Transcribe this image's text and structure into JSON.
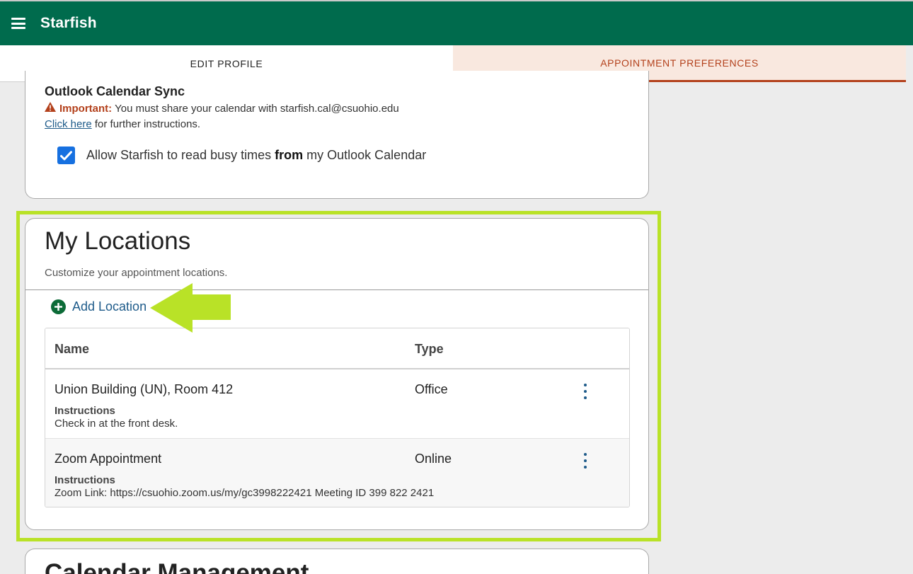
{
  "app": {
    "title": "Starfish"
  },
  "tabs": [
    {
      "label": "EDIT PROFILE",
      "active": false
    },
    {
      "label": "APPOINTMENT PREFERENCES",
      "active": true
    }
  ],
  "outlook": {
    "title": "Outlook Calendar Sync",
    "important_label": "Important:",
    "important_text": "You must share your calendar with starfish.cal@csuohio.edu",
    "link_text": "Click here",
    "link_suffix": "for further instructions.",
    "checkbox_checked": true,
    "checkbox_label_before": "Allow Starfish to read busy times",
    "checkbox_label_bold": "from",
    "checkbox_label_after": "my Outlook Calendar"
  },
  "locations": {
    "title": "My Locations",
    "subtitle": "Customize your appointment locations.",
    "add_label": "Add Location",
    "columns": {
      "name": "Name",
      "type": "Type"
    },
    "rows": [
      {
        "name": "Union Building (UN), Room 412",
        "type": "Office",
        "instructions_label": "Instructions",
        "instructions": "Check in at the front desk."
      },
      {
        "name": "Zoom Appointment",
        "type": "Online",
        "instructions_label": "Instructions",
        "instructions": "Zoom Link: https://csuohio.zoom.us/my/gc3998222421 Meeting ID 399 822 2421"
      }
    ]
  },
  "calendar": {
    "title": "Calendar Management"
  },
  "colors": {
    "brand_green": "#006b4d",
    "active_tab": "#b3401b",
    "highlight": "#b9e227",
    "link": "#1e5b8a",
    "checkbox": "#1670e0"
  },
  "icons": [
    "menu-icon",
    "warning-icon",
    "checkmark-icon",
    "plus-circle-icon",
    "more-vertical-icon",
    "pointer-arrow"
  ]
}
